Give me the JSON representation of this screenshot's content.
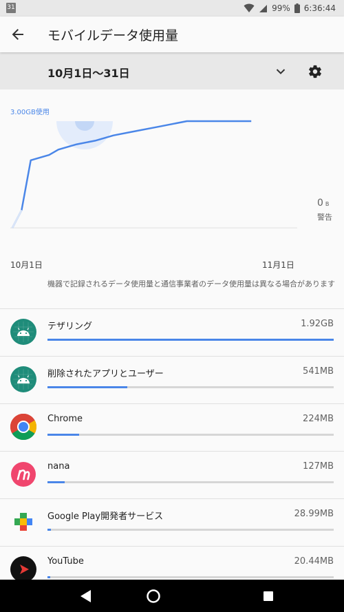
{
  "status_bar": {
    "calendar_day": "31",
    "battery": "99%",
    "time": "6:36:44",
    "icons": [
      "wifi-icon",
      "signal-icon",
      "battery-icon"
    ]
  },
  "app_bar": {
    "title": "モバイルデータ使用量",
    "back_icon": "arrow-back-icon"
  },
  "range": {
    "label": "10月1日〜31日",
    "dropdown_icon": "chevron-down-icon",
    "settings_icon": "gear-icon"
  },
  "chart": {
    "usage_label": "3.00GB使用",
    "limit_value": "0",
    "limit_unit": "B",
    "limit_label": "警告",
    "x_start": "10月1日",
    "x_end": "11月1日",
    "accent_color": "#4a86e8",
    "disclaimer": "機器で記録されるデータ使用量と通信事業者のデータ使用量は異なる場合があります"
  },
  "chart_data": {
    "type": "line",
    "x": [
      "10/1",
      "10/2",
      "10/3",
      "10/5",
      "10/6",
      "10/8",
      "10/10",
      "10/12",
      "10/14",
      "10/17",
      "10/20",
      "10/23",
      "10/25",
      "10/27"
    ],
    "series": [
      {
        "values": [
          0,
          0.5,
          1.9,
          2.05,
          2.2,
          2.35,
          2.45,
          2.6,
          2.7,
          2.85,
          3.0,
          3.0,
          3.0,
          3.0
        ]
      }
    ],
    "ylim": [
      0,
      3.0
    ]
  },
  "apps": [
    {
      "name": "テザリング",
      "size": "1.92GB",
      "fraction": 1.0,
      "icon": "android-icon"
    },
    {
      "name": "削除されたアプリとユーザー",
      "size": "541MB",
      "fraction": 0.28,
      "icon": "android-icon"
    },
    {
      "name": "Chrome",
      "size": "224MB",
      "fraction": 0.11,
      "icon": "chrome-icon"
    },
    {
      "name": "nana",
      "size": "127MB",
      "fraction": 0.06,
      "icon": "nana-icon"
    },
    {
      "name": "Google Play開発者サービス",
      "size": "28.99MB",
      "fraction": 0.012,
      "icon": "google-play-services-icon"
    },
    {
      "name": "YouTube",
      "size": "20.44MB",
      "fraction": 0.01,
      "icon": "youtube-icon"
    }
  ],
  "nav": {
    "back": "nav-back-icon",
    "home": "nav-home-icon",
    "recents": "nav-recents-icon"
  }
}
